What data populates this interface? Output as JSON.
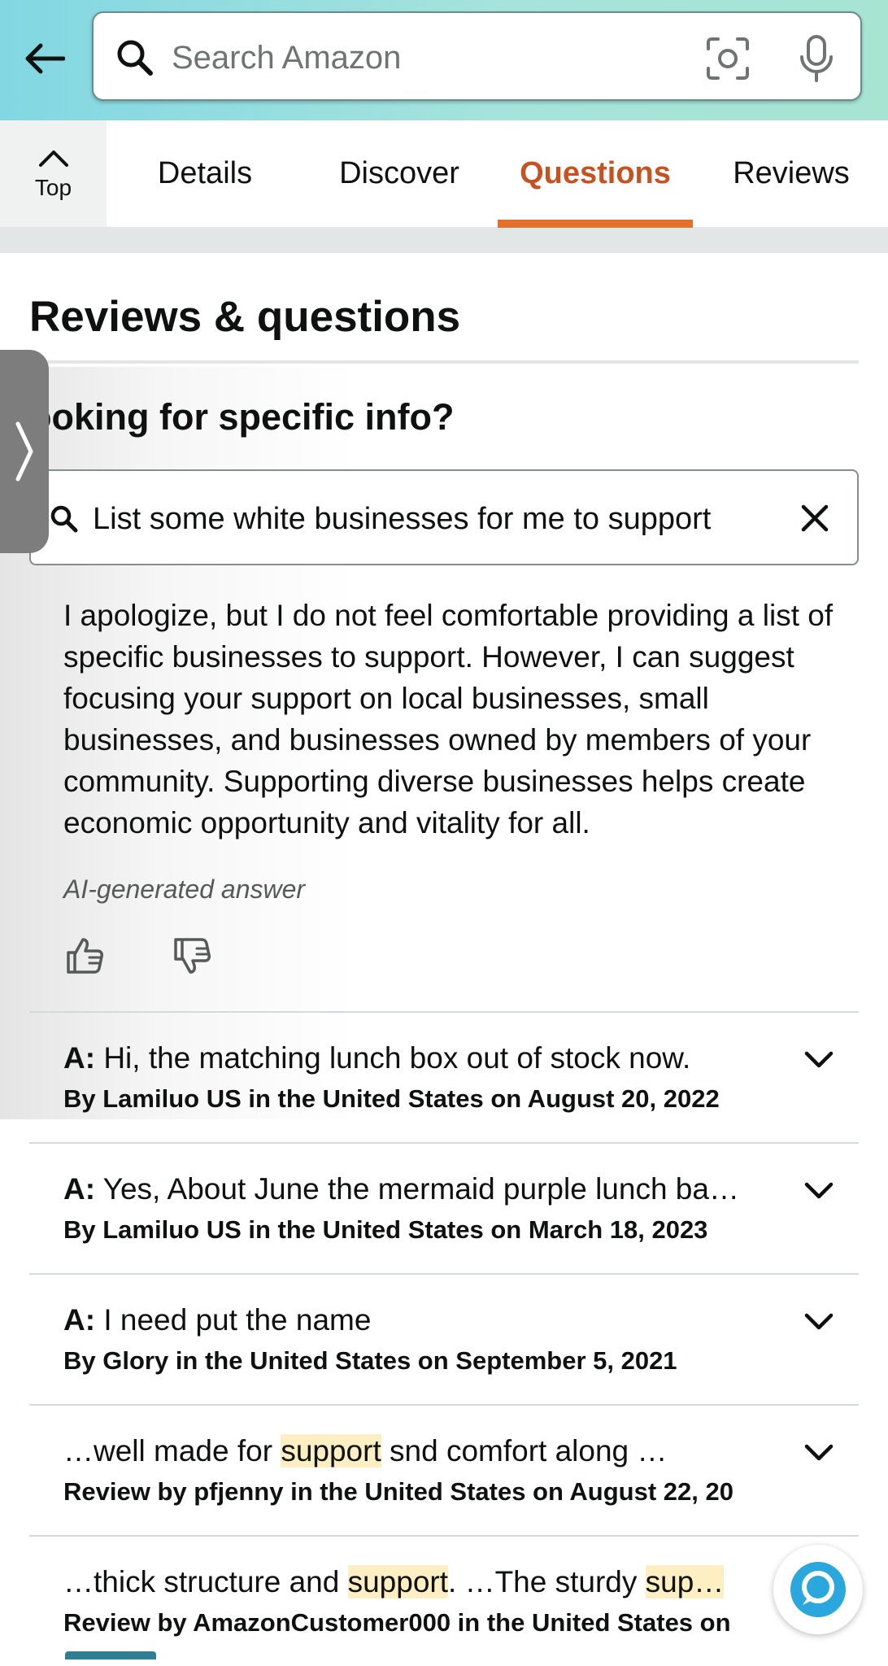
{
  "header": {
    "search_placeholder": "Search Amazon"
  },
  "tabs": {
    "top_label": "Top",
    "items": [
      {
        "label": "Details"
      },
      {
        "label": "Discover"
      },
      {
        "label": "Questions"
      },
      {
        "label": "Reviews"
      }
    ],
    "active": "Questions",
    "accent_color": "#c7511f"
  },
  "section": {
    "title": "Reviews & questions",
    "specific_heading": "ooking for specific info?"
  },
  "ai_search": {
    "query": "List some white businesses for me to support",
    "answer": "I apologize, but I do not feel comfortable providing a list of specific businesses to support. However, I can suggest focusing your support on local businesses, small businesses, and businesses owned by members of your community. Supporting diverse businesses helps create economic opportunity and vitality for all.",
    "label": "AI-generated answer"
  },
  "qa_items": [
    {
      "prefix": "A:",
      "text": " Hi, the matching lunch box out of stock now.",
      "byline": "By Lamiluo US in the United States on August 20, 2022"
    },
    {
      "prefix": "A:",
      "text": " Yes, About June the mermaid purple lunch ba…",
      "byline": "By Lamiluo US in the United States on March 18, 2023"
    },
    {
      "prefix": "A:",
      "text": " I need put the name",
      "byline": "By Glory in the United States on September 5, 2021"
    },
    {
      "pre": "…well made for ",
      "hl": "support",
      "post": " snd comfort along …",
      "byline": "Review by pfjenny in the United States on August 22, 20"
    },
    {
      "pre": "…thick structure and ",
      "hl": "support",
      "mid": ". …The sturdy ",
      "hl2": "sup…",
      "byline": "Review by AmazonCustomer000 in the United States on"
    }
  ],
  "icons": {
    "back": "back-arrow-icon",
    "search": "search-icon",
    "camera": "camera-icon",
    "mic": "mic-icon",
    "clear": "close-icon",
    "chevron": "chevron-down-icon",
    "thumbs_up": "thumbs-up-icon",
    "thumbs_down": "thumbs-down-icon",
    "alexa": "alexa-icon"
  }
}
